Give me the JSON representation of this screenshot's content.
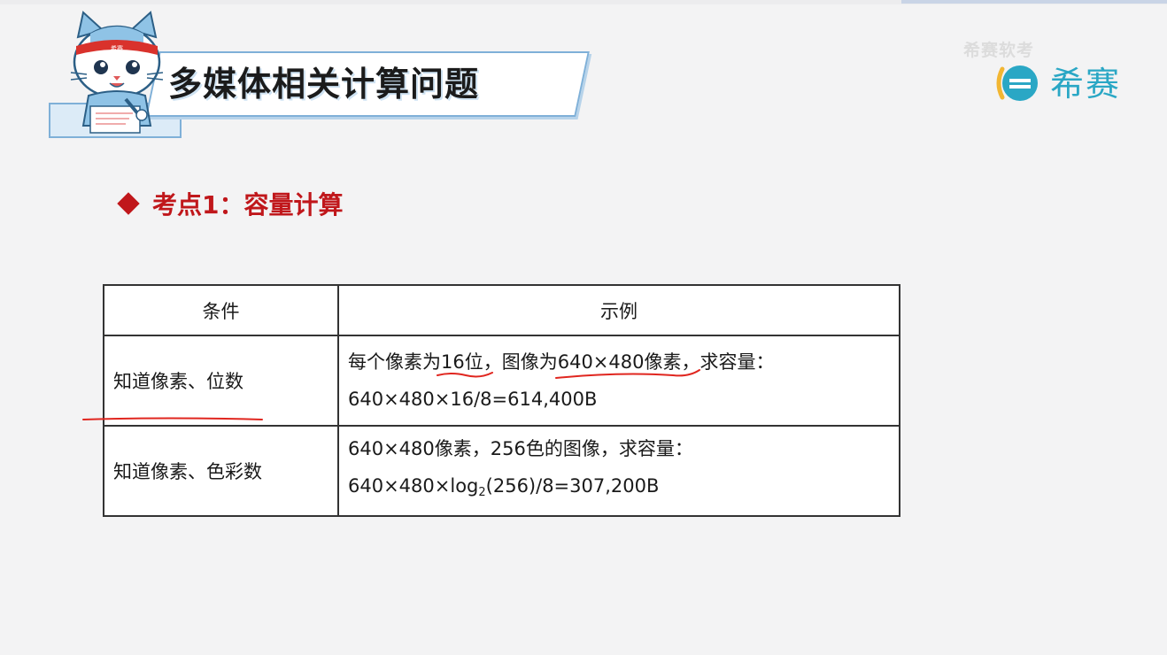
{
  "page": {
    "title": "多媒体相关计算问题",
    "watermark": "希赛软考",
    "logo_text": "希赛",
    "mascot_band_text": "希赛"
  },
  "section": {
    "heading": "考点1：容量计算"
  },
  "table": {
    "headers": [
      "条件",
      "示例"
    ],
    "rows": [
      {
        "condition": "知道像素、位数",
        "example_line1": "每个像素为16位，图像为640×480像素，求容量：",
        "example_line2": "640×480×16/8=614,400B"
      },
      {
        "condition": "知道像素、色彩数",
        "example_line1": "640×480像素，256色的图像，求容量：",
        "example_line2_prefix": "640×480×log",
        "example_line2_sub": "2",
        "example_line2_suffix": "(256)/8=307,200B"
      }
    ]
  },
  "colors": {
    "accent_red": "#c0171b",
    "brand_teal": "#2aa7c5",
    "banner_blue": "#7fb0d8",
    "annotation_red": "#e0261f"
  }
}
